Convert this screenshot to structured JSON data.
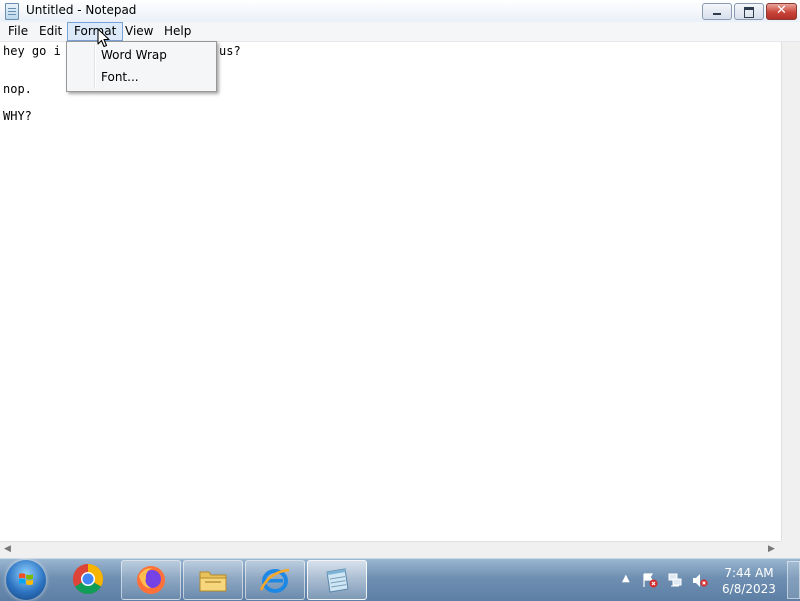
{
  "window": {
    "title": "Untitled - Notepad"
  },
  "menu": {
    "file": "File",
    "edit": "Edit",
    "format": "Format",
    "view": "View",
    "help": "Help"
  },
  "format_menu": {
    "items": [
      "Word Wrap",
      "Font..."
    ]
  },
  "editor": {
    "lines": [
      "hey go i",
      "nop.",
      "WHY?"
    ],
    "line1_tail": "us?"
  },
  "taskbar": {
    "apps": [
      "start-orb",
      "chrome-icon",
      "firefox-icon",
      "explorer-icon",
      "ie-icon",
      "notepad-icon"
    ],
    "active_app": "Notepad",
    "clock": {
      "time": "7:44 AM",
      "date": "6/8/2023"
    }
  },
  "colors": {
    "menu_highlight": "#dce9f8",
    "close_button": "#c9453a",
    "taskbar": "#6e8fb2"
  }
}
